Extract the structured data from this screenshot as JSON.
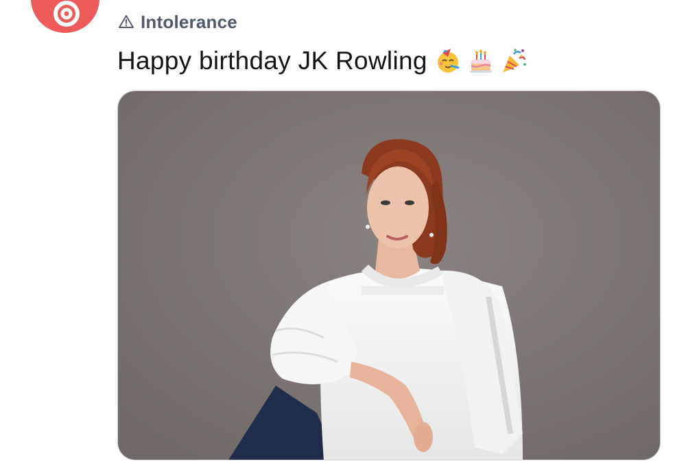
{
  "community": {
    "icon": "warning-triangle-icon",
    "name": "Intolerance"
  },
  "post": {
    "title": "Happy birthday JK Rowling",
    "emojis": [
      "partying-face-icon",
      "birthday-cake-icon",
      "party-popper-icon"
    ]
  },
  "photo": {
    "subject": "portrait-photo"
  },
  "colors": {
    "avatar": "#ec5a5a",
    "community_text": "#4f5b6b",
    "photo_background": "#7d7674"
  }
}
